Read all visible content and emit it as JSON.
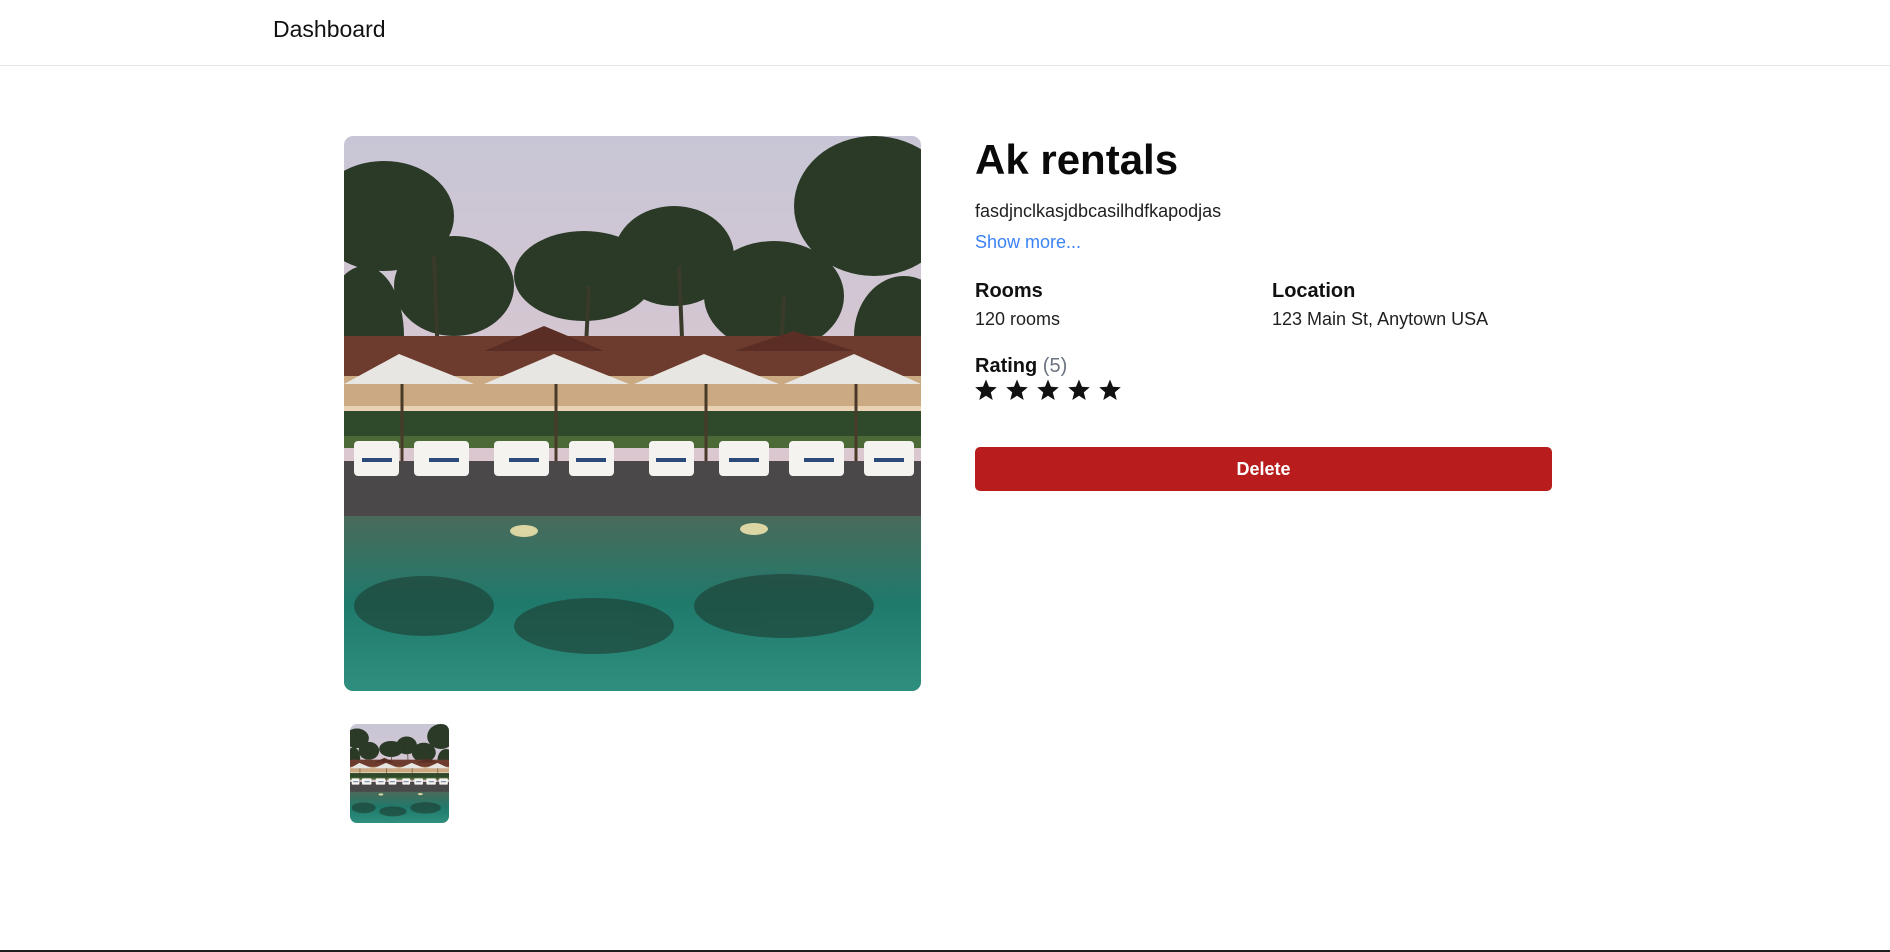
{
  "nav": {
    "brand": "Dashboard"
  },
  "listing": {
    "title": "Ak rentals",
    "description": "fasdjnclkasjdbcasilhdfkapodjas",
    "show_more": "Show more...",
    "rooms_label": "Rooms",
    "rooms_value": "120 rooms",
    "location_label": "Location",
    "location_value": "123 Main St, Anytown USA",
    "rating_label": "Rating",
    "rating_count": "(5)",
    "rating_stars": 5,
    "rating_max": 5,
    "delete_label": "Delete"
  },
  "gallery": {
    "main_image": "resort-pool-photo",
    "thumbnails": [
      "resort-pool-photo"
    ]
  },
  "colors": {
    "danger": "#b91c1c",
    "link": "#3b82f6",
    "star": "#111111"
  }
}
